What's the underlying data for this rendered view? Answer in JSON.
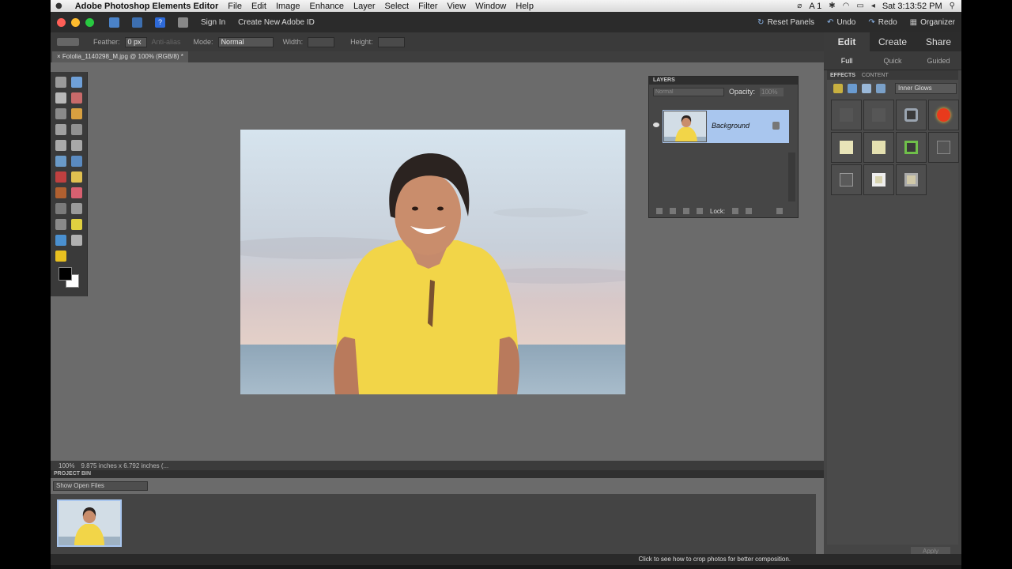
{
  "menubar": {
    "app_name": "Adobe Photoshop Elements Editor",
    "items": [
      "File",
      "Edit",
      "Image",
      "Enhance",
      "Layer",
      "Select",
      "Filter",
      "View",
      "Window",
      "Help"
    ],
    "clock": "Sat 3:13:52 PM",
    "status_text": "A 1"
  },
  "topbar": {
    "sign_in": "Sign In",
    "create_id": "Create New Adobe ID",
    "reset_panels": "Reset Panels",
    "undo": "Undo",
    "redo": "Redo",
    "organizer": "Organizer"
  },
  "options": {
    "feather_label": "Feather:",
    "feather_value": "0 px",
    "anti_alias": "Anti-alias",
    "mode_label": "Mode:",
    "mode_value": "Normal",
    "width_label": "Width:",
    "height_label": "Height:"
  },
  "document": {
    "tab_title": "Fotolia_1140298_M.jpg @ 100% (RGB/8) *",
    "zoom": "100%",
    "dimensions": "9.875 inches x 6.792 inches (..."
  },
  "layers_panel": {
    "title": "LAYERS",
    "blend_mode": "Normal",
    "opacity_label": "Opacity:",
    "opacity_value": "100%",
    "layer_name": "Background",
    "lock_label": "Lock:"
  },
  "right_panel": {
    "modes": [
      "Edit",
      "Create",
      "Share"
    ],
    "subtabs": [
      "Full",
      "Quick",
      "Guided"
    ],
    "effects_tab": "EFFECTS",
    "content_tab": "CONTENT",
    "category": "Inner Glows",
    "apply": "Apply",
    "swatch_colors": [
      "#555555",
      "#565656",
      "#9aa4b0",
      "#e83a1c",
      "#e8e4b8",
      "#e4e0b0",
      "#6fbf4a",
      "#555555",
      "#5a5a5a",
      "#d8d4b0",
      "#d0c8a8"
    ]
  },
  "project_bin": {
    "title": "PROJECT BIN",
    "filter": "Show Open Files"
  },
  "tip": "Click to see how to crop photos for better composition."
}
